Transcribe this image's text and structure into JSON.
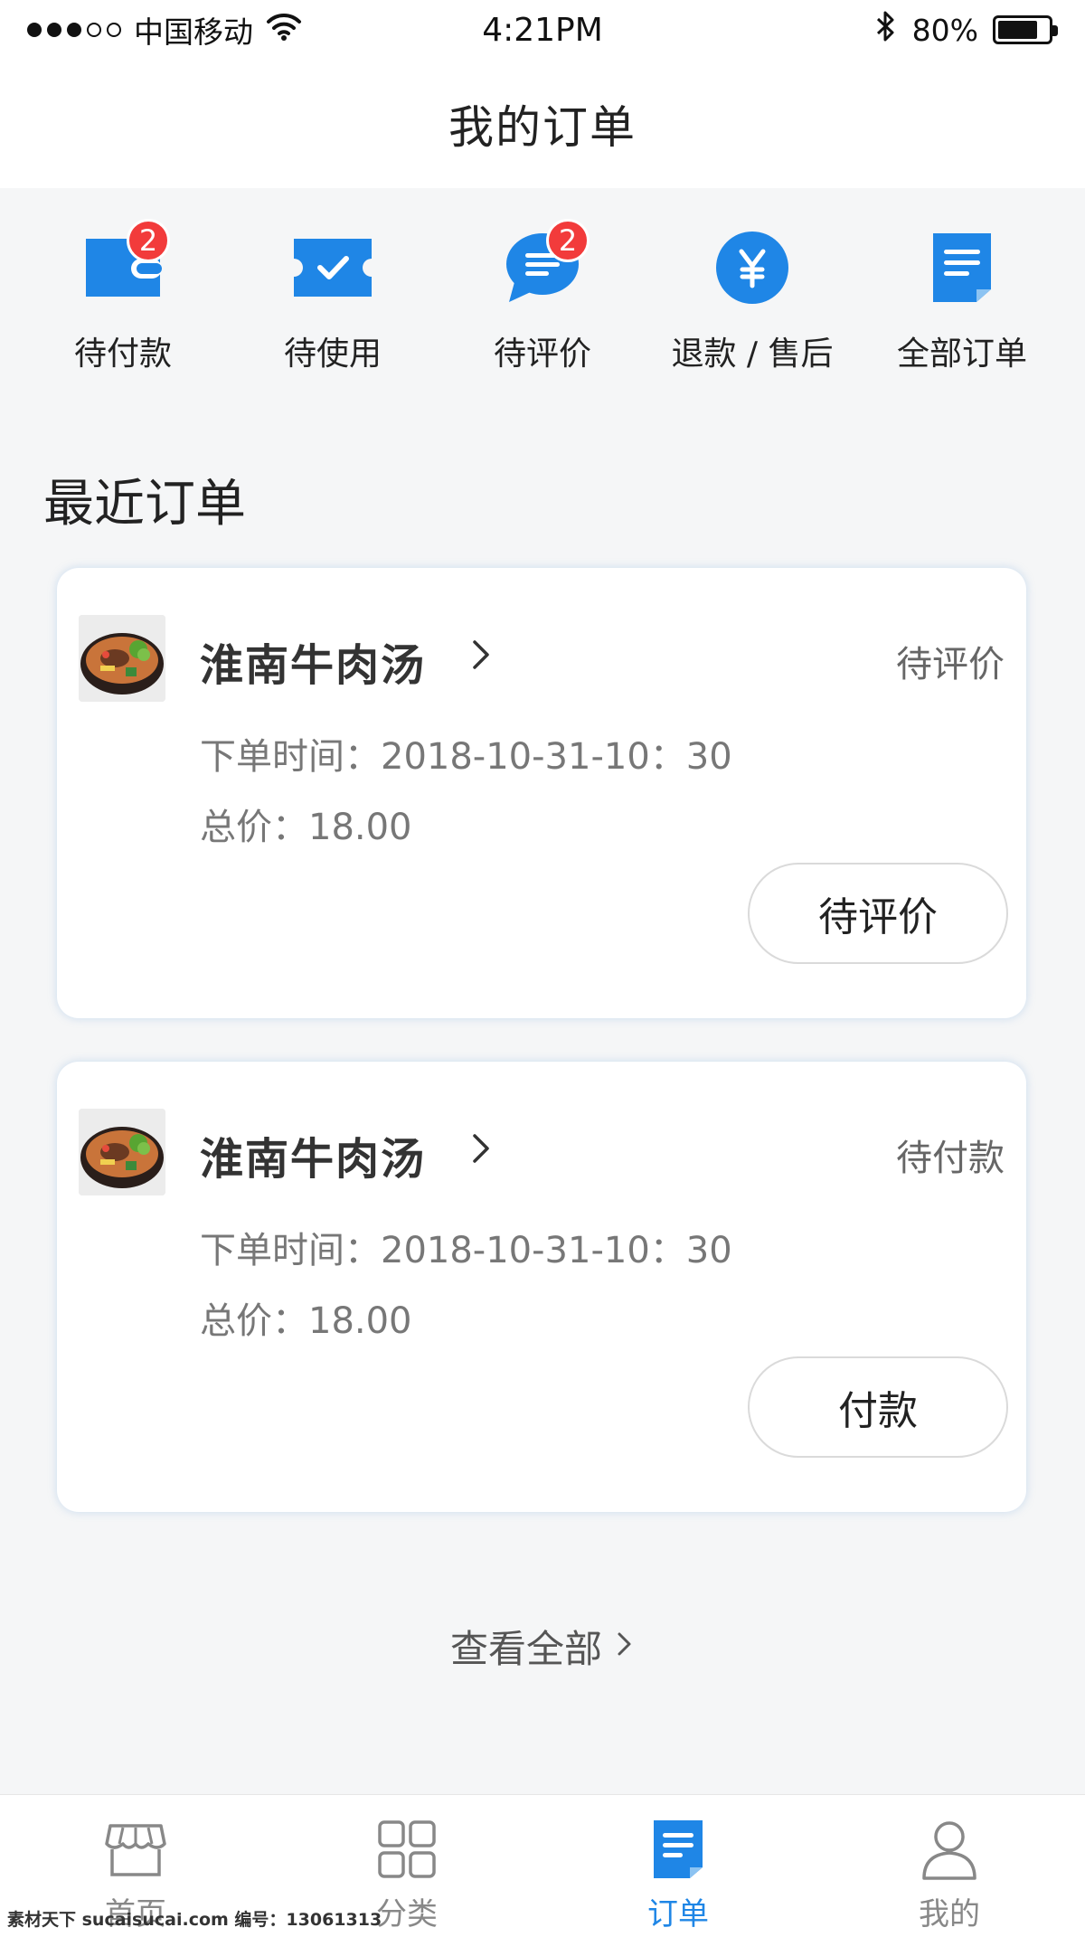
{
  "status_bar": {
    "carrier": "中国移动",
    "time": "4:21PM",
    "battery_level": "80%",
    "battery_fraction": 0.8
  },
  "header": {
    "title": "我的订单"
  },
  "quick_actions": [
    {
      "label": "待付款",
      "icon": "wallet-icon",
      "badge": "2"
    },
    {
      "label": "待使用",
      "icon": "ticket-icon",
      "badge": ""
    },
    {
      "label": "待评价",
      "icon": "chat-bubble-icon",
      "badge": "2"
    },
    {
      "label": "退款 / 售后",
      "icon": "yen-icon",
      "badge": ""
    },
    {
      "label": "全部订单",
      "icon": "document-icon",
      "badge": ""
    }
  ],
  "recent": {
    "title": "最近订单",
    "view_all": "查看全部"
  },
  "orders": [
    {
      "shop": "淮南牛肉汤",
      "status": "待评价",
      "time": "下单时间：2018-10-31-10：30",
      "total": "总价：18.00",
      "action": "待评价"
    },
    {
      "shop": "淮南牛肉汤",
      "status": "待付款",
      "time": "下单时间：2018-10-31-10：30",
      "total": "总价：18.00",
      "action": "付款"
    }
  ],
  "tabs": [
    {
      "label": "首页",
      "icon": "store-icon",
      "active": false
    },
    {
      "label": "分类",
      "icon": "grid-icon",
      "active": false
    },
    {
      "label": "订单",
      "icon": "order-icon",
      "active": true
    },
    {
      "label": "我的",
      "icon": "user-icon",
      "active": false
    }
  ],
  "colors": {
    "accent": "#1f86e6",
    "badge": "#f23b3b",
    "background": "#f5f6f7"
  },
  "watermark": "素材天下 sucaisucai.com  编号：13061313"
}
